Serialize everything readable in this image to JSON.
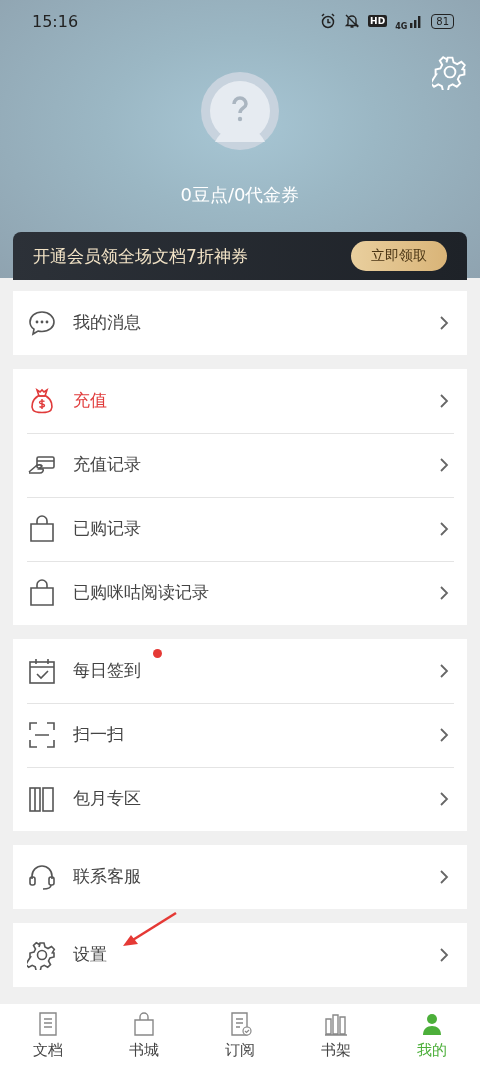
{
  "status_bar": {
    "time": "15:16",
    "hd_label": "HD",
    "network": "4G",
    "battery": "81"
  },
  "profile": {
    "balance": "0豆点/0代金券"
  },
  "promo": {
    "text": "开通会员领全场文档7折神券",
    "button": "立即领取"
  },
  "groups": [
    {
      "items": [
        {
          "label": "我的消息",
          "highlighted": false,
          "dot": false
        }
      ]
    },
    {
      "items": [
        {
          "label": "充值",
          "highlighted": true,
          "dot": false
        },
        {
          "label": "充值记录",
          "highlighted": false,
          "dot": false
        },
        {
          "label": "已购记录",
          "highlighted": false,
          "dot": false
        },
        {
          "label": "已购咪咕阅读记录",
          "highlighted": false,
          "dot": false
        }
      ]
    },
    {
      "items": [
        {
          "label": "每日签到",
          "highlighted": false,
          "dot": true
        },
        {
          "label": "扫一扫",
          "highlighted": false,
          "dot": false
        },
        {
          "label": "包月专区",
          "highlighted": false,
          "dot": false
        }
      ]
    },
    {
      "items": [
        {
          "label": "联系客服",
          "highlighted": false,
          "dot": false
        }
      ]
    },
    {
      "items": [
        {
          "label": "设置",
          "highlighted": false,
          "dot": false
        }
      ]
    }
  ],
  "tabs": [
    {
      "label": "文档",
      "selected": false
    },
    {
      "label": "书城",
      "selected": false
    },
    {
      "label": "订阅",
      "selected": false
    },
    {
      "label": "书架",
      "selected": false
    },
    {
      "label": "我的",
      "selected": true
    }
  ]
}
